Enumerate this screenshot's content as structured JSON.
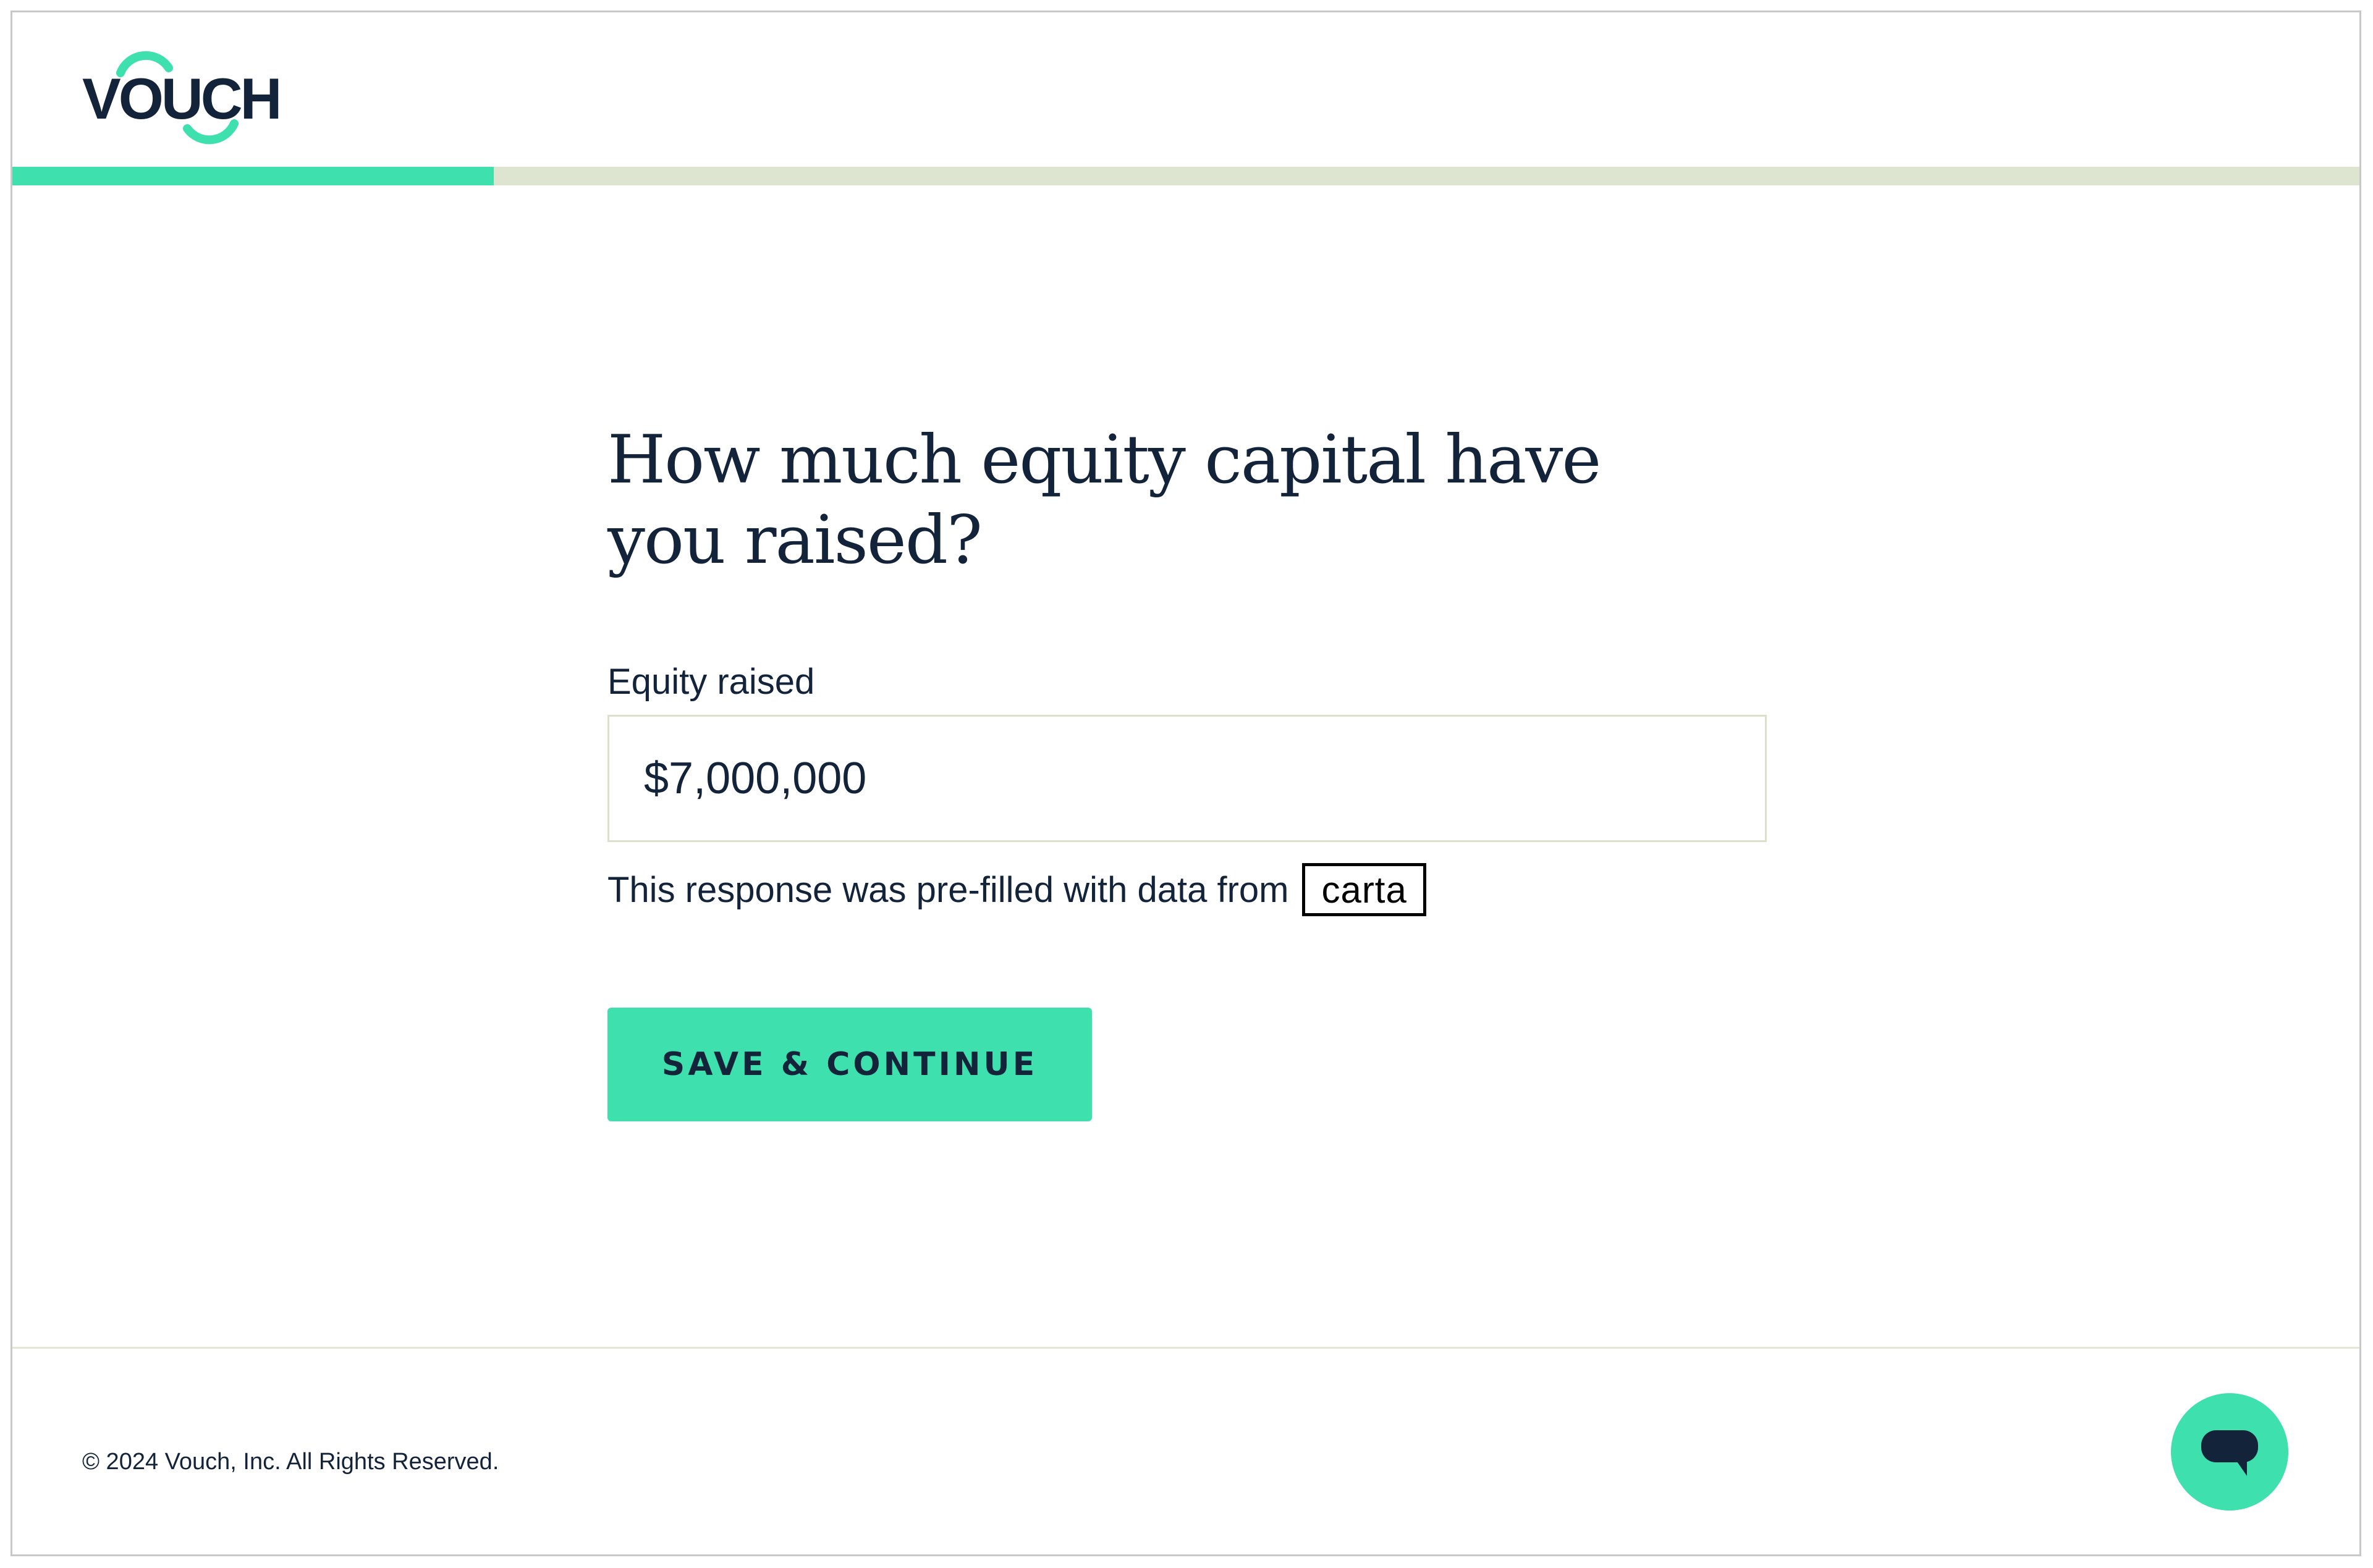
{
  "brand": {
    "logo_text": "VOUCH",
    "accent_color": "#3ee0ae",
    "text_color": "#13233a"
  },
  "progress": {
    "fraction": 0.205
  },
  "question": {
    "title": "How much equity capital have you raised?"
  },
  "field": {
    "label": "Equity raised",
    "value": "$7,000,000"
  },
  "prefill": {
    "text": "This response was pre-filled with data from",
    "source": "carta"
  },
  "actions": {
    "save_label": "SAVE & CONTINUE"
  },
  "footer": {
    "copyright": "© 2024 Vouch, Inc. All Rights Reserved.",
    "chat_icon": "chat-bubble-icon"
  }
}
